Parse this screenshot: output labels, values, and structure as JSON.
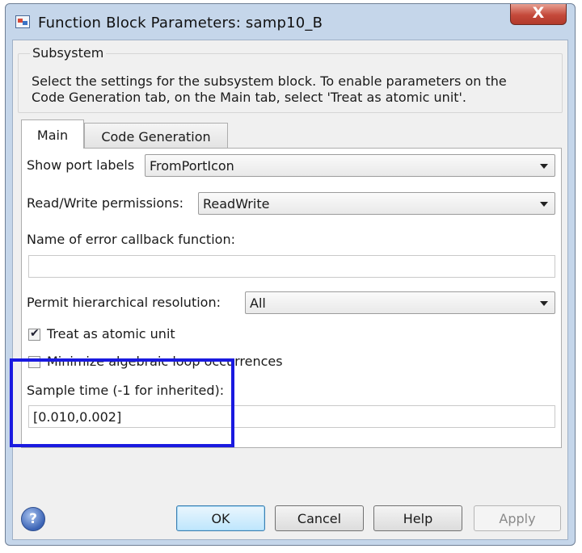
{
  "window": {
    "title": "Function Block Parameters: samp10_B",
    "close_symbol": "X"
  },
  "group": {
    "legend": "Subsystem",
    "description_line1": "Select the settings for the subsystem block. To enable parameters on the",
    "description_line2": "Code Generation tab, on the Main tab, select 'Treat as atomic unit'."
  },
  "tabs": [
    {
      "label": "Main",
      "active": true
    },
    {
      "label": "Code Generation",
      "active": false
    }
  ],
  "main": {
    "show_port_labels": {
      "label": "Show port labels",
      "value": "FromPortIcon"
    },
    "read_write": {
      "label": "Read/Write permissions:",
      "value": "ReadWrite"
    },
    "error_callback": {
      "label": "Name of error callback function:",
      "value": ""
    },
    "hierarchical": {
      "label": "Permit hierarchical resolution:",
      "value": "All"
    },
    "treat_atomic": {
      "label": "Treat as atomic unit",
      "checked": true
    },
    "minimize_loop": {
      "label": "Minimize algebraic loop occurrences",
      "checked": false
    },
    "sample_time": {
      "label": "Sample time (-1 for inherited):",
      "value": "[0.010,0.002]"
    }
  },
  "buttons": {
    "ok": "OK",
    "cancel": "Cancel",
    "help": "Help",
    "apply": "Apply",
    "help_icon_glyph": "?"
  },
  "colors": {
    "highlight_box": "#1a1ae0",
    "close_button": "#c4493a"
  }
}
